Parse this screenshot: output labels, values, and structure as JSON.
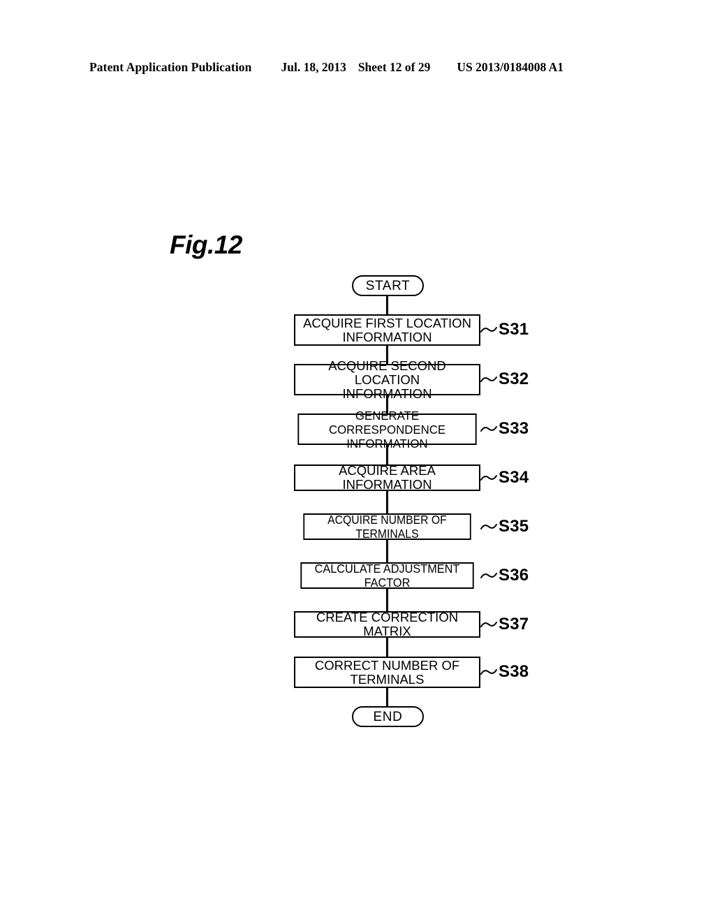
{
  "header": {
    "publication": "Patent Application Publication",
    "date": "Jul. 18, 2013",
    "sheet": "Sheet 12 of 29",
    "document_number": "US 2013/0184008 A1"
  },
  "figure": {
    "label": "Fig.12"
  },
  "flowchart": {
    "start_label": "START",
    "end_label": "END",
    "steps": [
      {
        "text": "ACQUIRE FIRST LOCATION\nINFORMATION",
        "step_id": "S31"
      },
      {
        "text": "ACQUIRE SECOND LOCATION\nINFORMATION",
        "step_id": "S32"
      },
      {
        "text": "GENERATE CORRESPONDENCE\nINFORMATION",
        "step_id": "S33"
      },
      {
        "text": "ACQUIRE AREA INFORMATION",
        "step_id": "S34"
      },
      {
        "text": "ACQUIRE NUMBER OF TERMINALS",
        "step_id": "S35"
      },
      {
        "text": "CALCULATE ADJUSTMENT FACTOR",
        "step_id": "S36"
      },
      {
        "text": "CREATE CORRECTION MATRIX",
        "step_id": "S37"
      },
      {
        "text": "CORRECT NUMBER OF\nTERMINALS",
        "step_id": "S38"
      }
    ]
  },
  "colors": {
    "ink": "#000000",
    "paper": "#ffffff"
  }
}
